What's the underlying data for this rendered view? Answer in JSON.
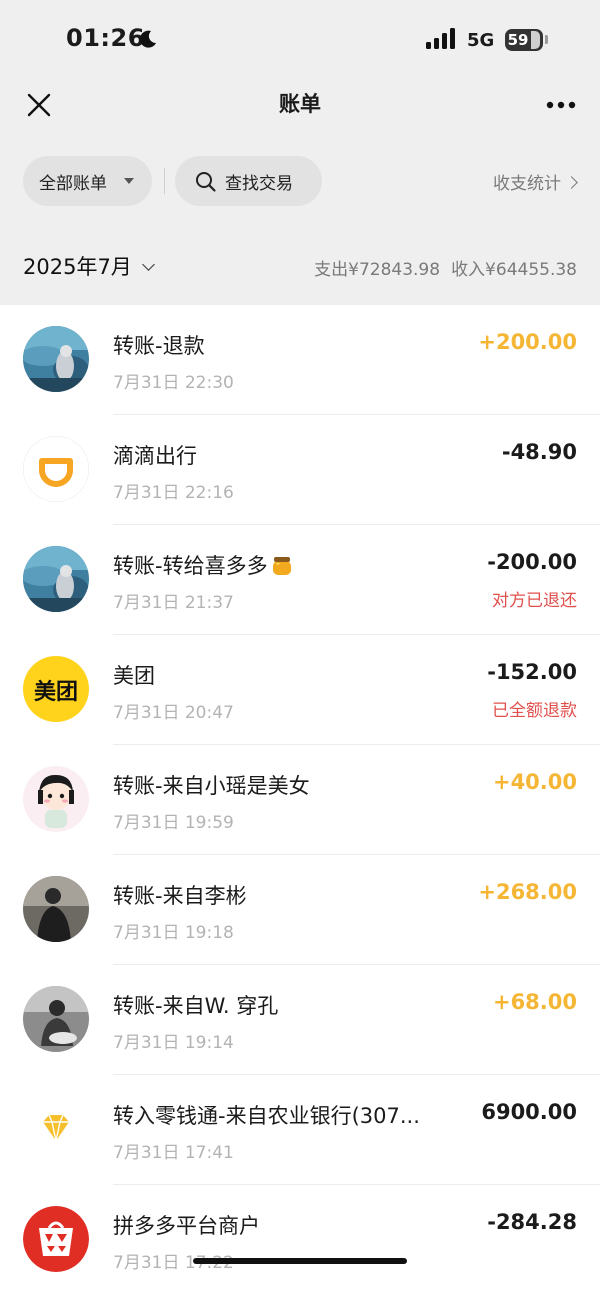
{
  "status_bar": {
    "time": "01:26",
    "network": "5G",
    "battery": "59"
  },
  "header": {
    "title": "账单"
  },
  "filters": {
    "all_bills": "全部账单",
    "search": "查找交易",
    "stats": "收支统计"
  },
  "summary": {
    "month": "2025年7月",
    "expense": "支出¥72843.98",
    "income": "收入¥64455.38"
  },
  "transactions": [
    {
      "name": "转账-退款",
      "time": "7月31日 22:30",
      "amount": "+200.00",
      "type": "income",
      "note": "",
      "avatar": "ocean-photo"
    },
    {
      "name": "滴滴出行",
      "time": "7月31日 22:16",
      "amount": "-48.90",
      "type": "expense",
      "note": "",
      "avatar": "didi-logo"
    },
    {
      "name": "转账-转给喜多多",
      "time": "7月31日 21:37",
      "amount": "-200.00",
      "type": "expense",
      "note": "对方已退还",
      "avatar": "ocean-photo"
    },
    {
      "name": "美团",
      "time": "7月31日 20:47",
      "amount": "-152.00",
      "type": "expense",
      "note": "已全额退款",
      "avatar": "meituan-logo",
      "logo_text": "美团"
    },
    {
      "name": "转账-来自小瑶是美女",
      "time": "7月31日 19:59",
      "amount": "+40.00",
      "type": "income",
      "note": "",
      "avatar": "cartoon-girl"
    },
    {
      "name": "转账-来自李彬",
      "time": "7月31日 19:18",
      "amount": "+268.00",
      "type": "income",
      "note": "",
      "avatar": "dark-photo"
    },
    {
      "name": "转账-来自W. 穿孔",
      "time": "7月31日 19:14",
      "amount": "+68.00",
      "type": "income",
      "note": "",
      "avatar": "bw-photo"
    },
    {
      "name": "转入零钱通-来自农业银行(307...",
      "time": "7月31日 17:41",
      "amount": "6900.00",
      "type": "neutral",
      "note": "",
      "avatar": "diamond-icon"
    },
    {
      "name": "拼多多平台商户",
      "time": "7月31日 17:22",
      "amount": "-284.28",
      "type": "expense",
      "note": "",
      "avatar": "pinduoduo-logo"
    }
  ],
  "colors": {
    "income": "#f4b634",
    "refund_note": "#e0504c",
    "meituan": "#ffd21c",
    "pinduoduo": "#e02e24",
    "didi": "#f7a623"
  }
}
